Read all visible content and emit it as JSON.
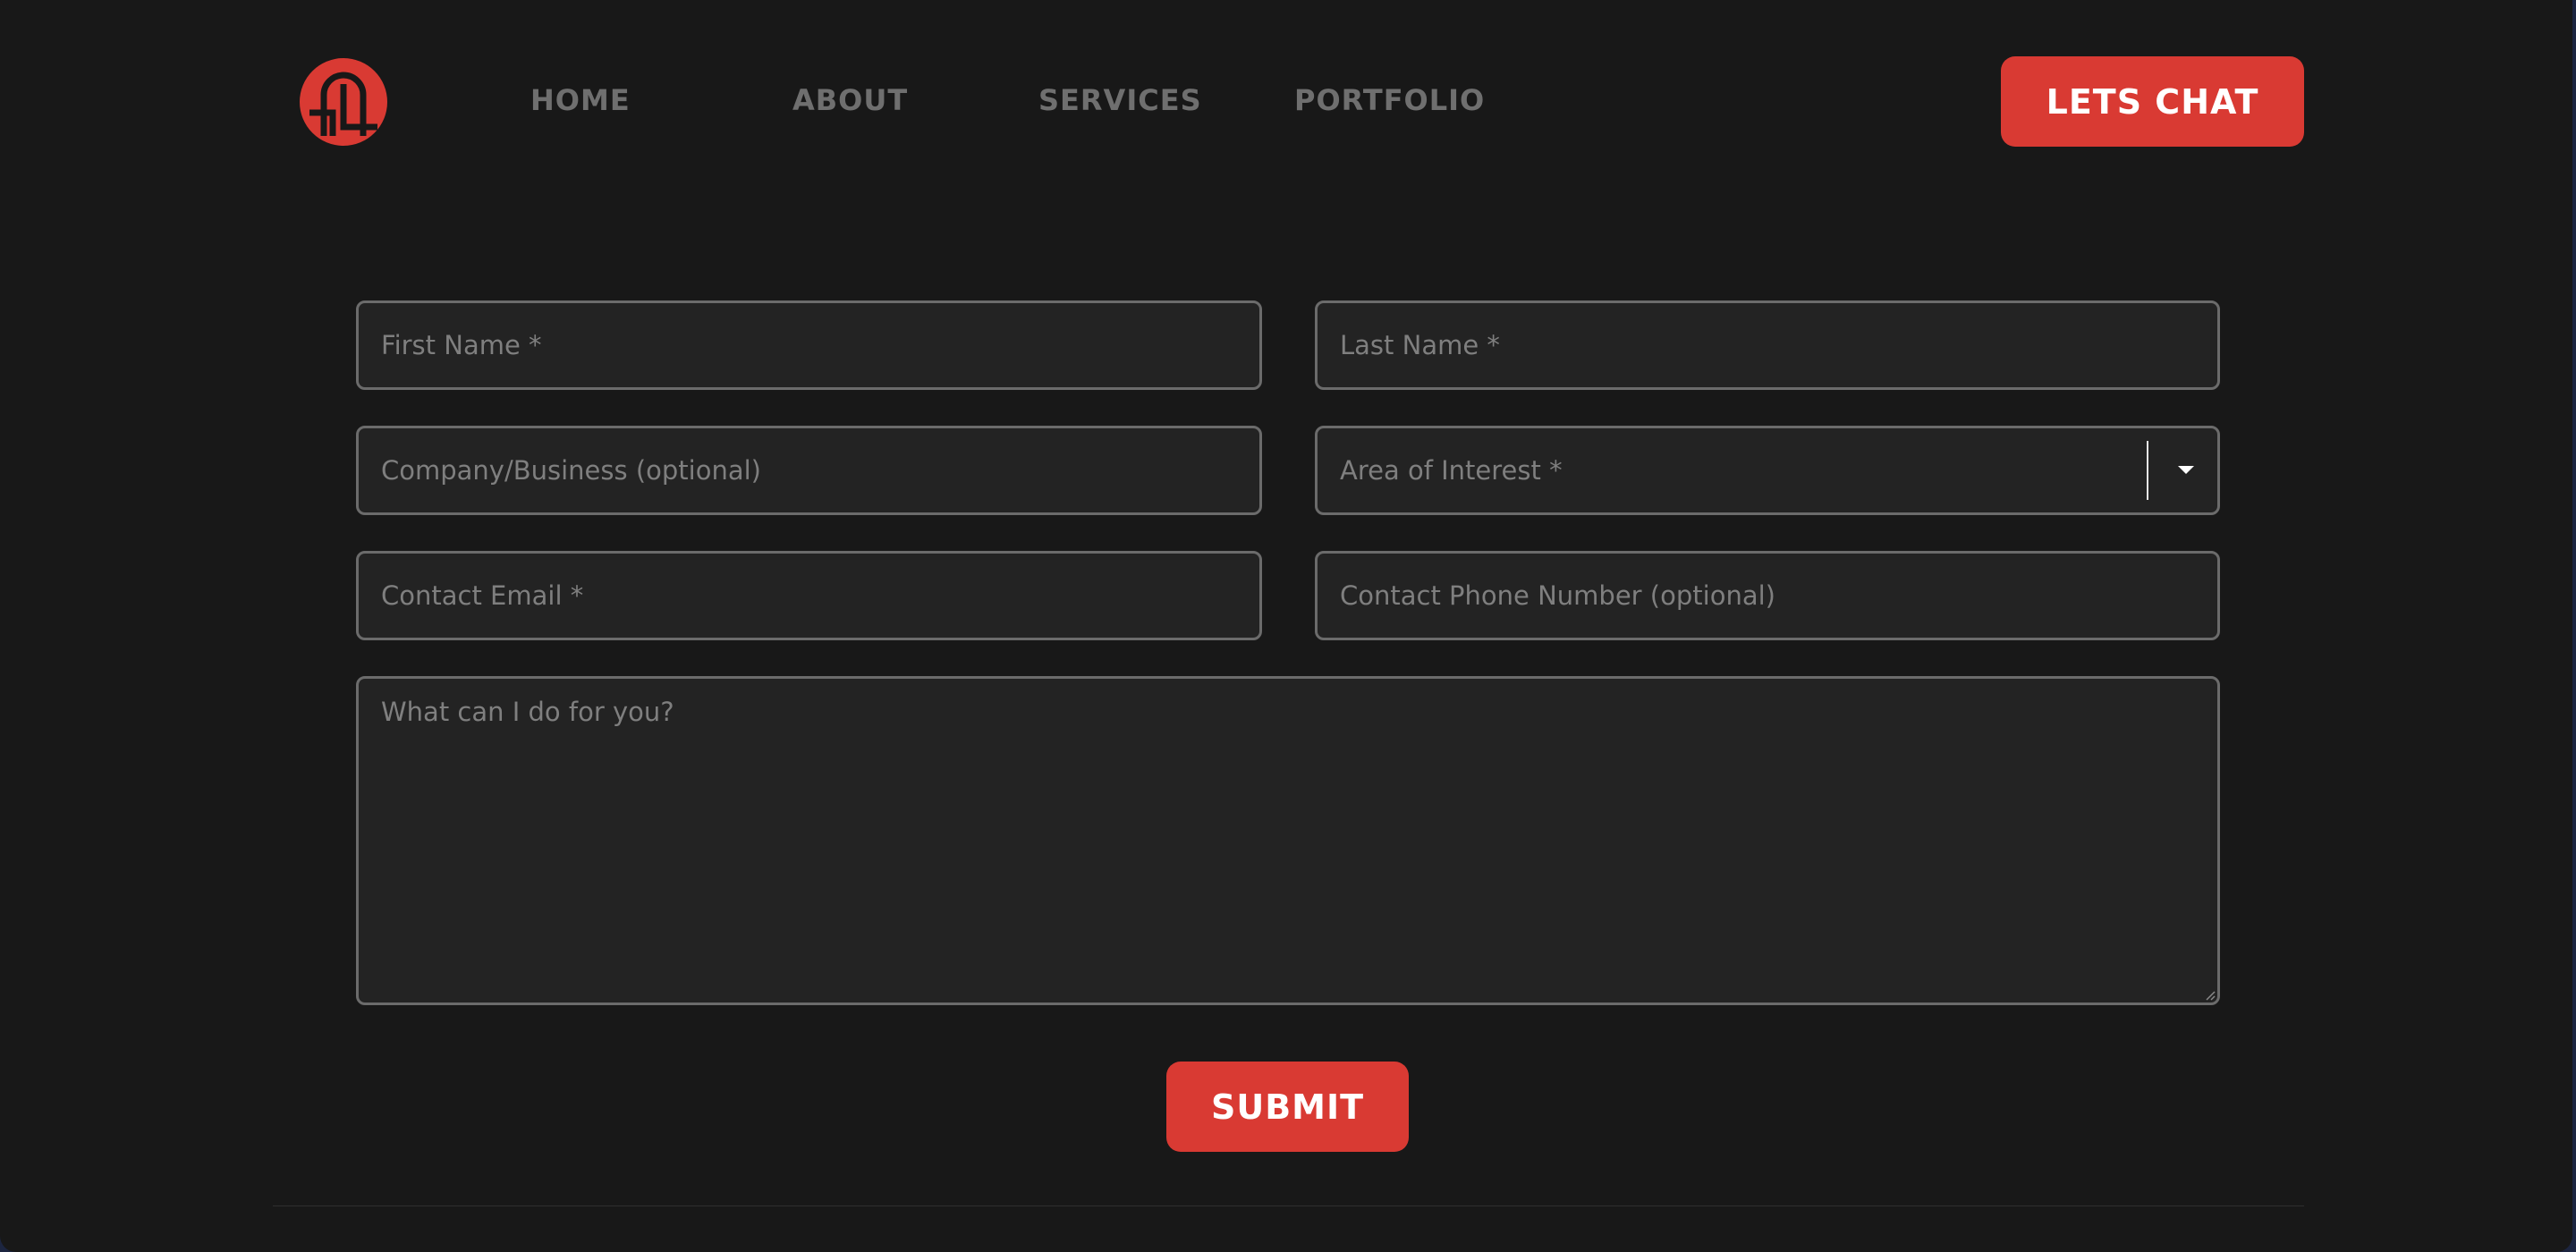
{
  "header": {
    "logo_icon": "brand-logo-icon",
    "nav": [
      {
        "label": "HOME"
      },
      {
        "label": "ABOUT"
      },
      {
        "label": "SERVICES"
      },
      {
        "label": "PORTFOLIO"
      }
    ],
    "cta_label": "LETS CHAT"
  },
  "form": {
    "first_name": {
      "value": "",
      "placeholder": "First Name *"
    },
    "last_name": {
      "value": "",
      "placeholder": "Last Name *"
    },
    "company": {
      "value": "",
      "placeholder": "Company/Business (optional)"
    },
    "area_of_interest": {
      "selected": "Area of Interest *",
      "icon": "chevron-down-icon"
    },
    "email": {
      "value": "",
      "placeholder": "Contact Email *"
    },
    "phone": {
      "value": "",
      "placeholder": "Contact Phone Number (optional)"
    },
    "message": {
      "value": "",
      "placeholder": "What can I do for you?"
    },
    "submit_label": "SUBMIT"
  },
  "colors": {
    "accent": "#d93a33",
    "background": "#181818",
    "field_background": "#232323",
    "field_border": "#6b6b6b",
    "nav_text": "#6f6f6f"
  }
}
